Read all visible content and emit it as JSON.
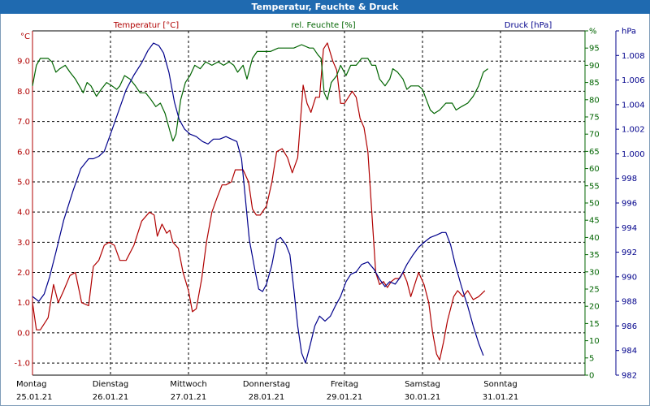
{
  "chart_data": {
    "type": "line",
    "title": "Temperatur, Feuchte & Druck",
    "x_range": [
      0,
      7
    ],
    "x_ticks": [
      {
        "day": "Montag",
        "date": "25.01.21"
      },
      {
        "day": "Dienstag",
        "date": "26.01.21"
      },
      {
        "day": "Mittwoch",
        "date": "27.01.21"
      },
      {
        "day": "Donnerstag",
        "date": "28.01.21"
      },
      {
        "day": "Freitag",
        "date": "29.01.21"
      },
      {
        "day": "Samstag",
        "date": "30.01.21"
      },
      {
        "day": "Sonntag",
        "date": "31.01.21"
      }
    ],
    "axes": {
      "temperature": {
        "unit": "°C",
        "ylim": [
          -1.4,
          10.0
        ],
        "position": "left",
        "ticks": [
          "-1.0",
          "0.0",
          "1.0",
          "2.0",
          "3.0",
          "4.0",
          "5.0",
          "6.0",
          "7.0",
          "8.0",
          "9.0"
        ],
        "tick_values": [
          -1,
          0,
          1,
          2,
          3,
          4,
          5,
          6,
          7,
          8,
          9
        ]
      },
      "humidity": {
        "unit": "%",
        "ylim": [
          0,
          100
        ],
        "position": "right-inner",
        "ticks": [
          "0",
          "5",
          "10",
          "15",
          "20",
          "25",
          "30",
          "35",
          "40",
          "45",
          "50",
          "55",
          "60",
          "65",
          "70",
          "75",
          "80",
          "85",
          "90",
          "95",
          "%"
        ],
        "tick_values": [
          0,
          5,
          10,
          15,
          20,
          25,
          30,
          35,
          40,
          45,
          50,
          55,
          60,
          65,
          70,
          75,
          80,
          85,
          90,
          95,
          100
        ]
      },
      "pressure": {
        "unit": "hPa",
        "ylim": [
          982,
          1010
        ],
        "position": "right-outer",
        "ticks": [
          "982",
          "984",
          "986",
          "988",
          "990",
          "992",
          "994",
          "996",
          "998",
          "1.000",
          "1.002",
          "1.004",
          "1.006",
          "1.008",
          "hPa"
        ],
        "tick_values": [
          982,
          984,
          986,
          988,
          990,
          992,
          994,
          996,
          998,
          1000,
          1002,
          1004,
          1006,
          1008,
          1010
        ]
      }
    },
    "grid": true,
    "series": [
      {
        "name": "Temperatur [°C]",
        "axis": "temperature",
        "color": "#b00000",
        "points": [
          [
            0.0,
            1.0
          ],
          [
            0.05,
            0.1
          ],
          [
            0.1,
            0.1
          ],
          [
            0.2,
            0.5
          ],
          [
            0.27,
            1.6
          ],
          [
            0.33,
            1.0
          ],
          [
            0.4,
            1.4
          ],
          [
            0.48,
            1.9
          ],
          [
            0.55,
            2.0
          ],
          [
            0.63,
            1.0
          ],
          [
            0.72,
            0.9
          ],
          [
            0.78,
            2.2
          ],
          [
            0.85,
            2.4
          ],
          [
            0.92,
            2.9
          ],
          [
            0.98,
            3.0
          ],
          [
            1.05,
            2.9
          ],
          [
            1.12,
            2.4
          ],
          [
            1.2,
            2.4
          ],
          [
            1.3,
            2.9
          ],
          [
            1.4,
            3.7
          ],
          [
            1.5,
            4.0
          ],
          [
            1.56,
            3.9
          ],
          [
            1.6,
            3.2
          ],
          [
            1.66,
            3.6
          ],
          [
            1.72,
            3.3
          ],
          [
            1.76,
            3.4
          ],
          [
            1.8,
            3.0
          ],
          [
            1.87,
            2.8
          ],
          [
            1.93,
            2.0
          ],
          [
            2.0,
            1.4
          ],
          [
            2.05,
            0.7
          ],
          [
            2.1,
            0.8
          ],
          [
            2.17,
            1.8
          ],
          [
            2.23,
            3.0
          ],
          [
            2.3,
            4.0
          ],
          [
            2.37,
            4.5
          ],
          [
            2.43,
            4.9
          ],
          [
            2.48,
            4.9
          ],
          [
            2.55,
            5.0
          ],
          [
            2.6,
            5.4
          ],
          [
            2.7,
            5.4
          ],
          [
            2.77,
            5.0
          ],
          [
            2.82,
            4.1
          ],
          [
            2.87,
            3.9
          ],
          [
            2.92,
            3.9
          ],
          [
            3.0,
            4.2
          ],
          [
            3.07,
            5.0
          ],
          [
            3.13,
            6.0
          ],
          [
            3.2,
            6.1
          ],
          [
            3.27,
            5.8
          ],
          [
            3.33,
            5.3
          ],
          [
            3.4,
            5.8
          ],
          [
            3.47,
            8.2
          ],
          [
            3.52,
            7.6
          ],
          [
            3.57,
            7.3
          ],
          [
            3.63,
            7.8
          ],
          [
            3.68,
            7.8
          ],
          [
            3.73,
            9.4
          ],
          [
            3.78,
            9.6
          ],
          [
            3.85,
            9.0
          ],
          [
            3.9,
            8.7
          ],
          [
            3.95,
            7.6
          ],
          [
            4.0,
            7.6
          ],
          [
            4.05,
            7.8
          ],
          [
            4.1,
            8.0
          ],
          [
            4.15,
            7.8
          ],
          [
            4.2,
            7.1
          ],
          [
            4.25,
            6.8
          ],
          [
            4.3,
            6.0
          ],
          [
            4.35,
            4.0
          ],
          [
            4.4,
            2.0
          ],
          [
            4.45,
            1.6
          ],
          [
            4.5,
            1.7
          ],
          [
            4.55,
            1.5
          ],
          [
            4.6,
            1.7
          ],
          [
            4.65,
            1.8
          ],
          [
            4.7,
            1.8
          ],
          [
            4.75,
            2.0
          ],
          [
            4.8,
            1.7
          ],
          [
            4.85,
            1.2
          ],
          [
            4.9,
            1.6
          ],
          [
            4.95,
            2.0
          ],
          [
            5.02,
            1.6
          ],
          [
            5.08,
            1.0
          ],
          [
            5.13,
            0.0
          ],
          [
            5.18,
            -0.7
          ],
          [
            5.22,
            -0.9
          ],
          [
            5.27,
            -0.3
          ],
          [
            5.32,
            0.4
          ],
          [
            5.4,
            1.2
          ],
          [
            5.45,
            1.4
          ],
          [
            5.52,
            1.2
          ],
          [
            5.58,
            1.4
          ],
          [
            5.65,
            1.1
          ],
          [
            5.72,
            1.2
          ],
          [
            5.8,
            1.4
          ]
        ]
      },
      {
        "name": "rel. Feuchte [%]",
        "axis": "humidity",
        "color": "#006400",
        "points": [
          [
            0.0,
            84
          ],
          [
            0.05,
            90
          ],
          [
            0.1,
            92
          ],
          [
            0.2,
            92
          ],
          [
            0.25,
            91
          ],
          [
            0.3,
            88
          ],
          [
            0.35,
            89
          ],
          [
            0.42,
            90
          ],
          [
            0.48,
            88
          ],
          [
            0.55,
            86
          ],
          [
            0.6,
            84
          ],
          [
            0.65,
            82
          ],
          [
            0.7,
            85
          ],
          [
            0.75,
            84
          ],
          [
            0.82,
            81
          ],
          [
            0.88,
            83
          ],
          [
            0.95,
            85
          ],
          [
            1.02,
            84
          ],
          [
            1.08,
            83
          ],
          [
            1.12,
            84
          ],
          [
            1.18,
            87
          ],
          [
            1.25,
            86
          ],
          [
            1.32,
            84
          ],
          [
            1.38,
            82
          ],
          [
            1.45,
            82
          ],
          [
            1.52,
            80
          ],
          [
            1.58,
            78
          ],
          [
            1.64,
            79
          ],
          [
            1.7,
            76
          ],
          [
            1.76,
            71
          ],
          [
            1.8,
            68
          ],
          [
            1.84,
            70
          ],
          [
            1.9,
            80
          ],
          [
            1.96,
            85
          ],
          [
            2.02,
            87
          ],
          [
            2.08,
            90
          ],
          [
            2.15,
            89
          ],
          [
            2.22,
            91
          ],
          [
            2.3,
            90
          ],
          [
            2.38,
            91
          ],
          [
            2.45,
            90
          ],
          [
            2.52,
            91
          ],
          [
            2.58,
            90
          ],
          [
            2.63,
            88
          ],
          [
            2.7,
            90
          ],
          [
            2.75,
            86
          ],
          [
            2.82,
            92
          ],
          [
            2.88,
            94
          ],
          [
            2.95,
            94
          ],
          [
            3.05,
            94
          ],
          [
            3.15,
            95
          ],
          [
            3.25,
            95
          ],
          [
            3.35,
            95
          ],
          [
            3.45,
            96
          ],
          [
            3.55,
            95
          ],
          [
            3.6,
            95
          ],
          [
            3.66,
            93
          ],
          [
            3.7,
            92
          ],
          [
            3.74,
            82
          ],
          [
            3.78,
            80
          ],
          [
            3.83,
            85
          ],
          [
            3.9,
            87
          ],
          [
            3.95,
            90
          ],
          [
            4.02,
            87
          ],
          [
            4.08,
            90
          ],
          [
            4.15,
            90
          ],
          [
            4.22,
            92
          ],
          [
            4.3,
            92
          ],
          [
            4.35,
            90
          ],
          [
            4.4,
            90
          ],
          [
            4.45,
            86
          ],
          [
            4.52,
            84
          ],
          [
            4.58,
            86
          ],
          [
            4.62,
            89
          ],
          [
            4.68,
            88
          ],
          [
            4.75,
            86
          ],
          [
            4.8,
            83
          ],
          [
            4.85,
            84
          ],
          [
            4.9,
            84
          ],
          [
            4.95,
            84
          ],
          [
            5.0,
            83
          ],
          [
            5.05,
            80
          ],
          [
            5.1,
            77
          ],
          [
            5.15,
            76
          ],
          [
            5.22,
            77
          ],
          [
            5.3,
            79
          ],
          [
            5.38,
            79
          ],
          [
            5.43,
            77
          ],
          [
            5.5,
            78
          ],
          [
            5.58,
            79
          ],
          [
            5.65,
            81
          ],
          [
            5.72,
            84
          ],
          [
            5.78,
            88
          ],
          [
            5.84,
            89
          ]
        ]
      },
      {
        "name": "Druck [hPa]",
        "axis": "pressure",
        "color": "#00008b",
        "points": [
          [
            0.0,
            988.4
          ],
          [
            0.08,
            988.0
          ],
          [
            0.15,
            988.6
          ],
          [
            0.22,
            990.0
          ],
          [
            0.3,
            992.0
          ],
          [
            0.4,
            994.6
          ],
          [
            0.52,
            997.0
          ],
          [
            0.62,
            998.8
          ],
          [
            0.72,
            999.6
          ],
          [
            0.78,
            999.6
          ],
          [
            0.85,
            999.8
          ],
          [
            0.92,
            1000.2
          ],
          [
            1.0,
            1001.6
          ],
          [
            1.1,
            1003.4
          ],
          [
            1.2,
            1005.2
          ],
          [
            1.3,
            1006.4
          ],
          [
            1.4,
            1007.4
          ],
          [
            1.48,
            1008.4
          ],
          [
            1.55,
            1009.0
          ],
          [
            1.62,
            1008.8
          ],
          [
            1.68,
            1008.2
          ],
          [
            1.75,
            1006.6
          ],
          [
            1.82,
            1004.2
          ],
          [
            1.88,
            1002.8
          ],
          [
            1.95,
            1002.0
          ],
          [
            2.02,
            1001.6
          ],
          [
            2.1,
            1001.4
          ],
          [
            2.18,
            1001.0
          ],
          [
            2.25,
            1000.8
          ],
          [
            2.32,
            1001.2
          ],
          [
            2.4,
            1001.2
          ],
          [
            2.48,
            1001.4
          ],
          [
            2.55,
            1001.2
          ],
          [
            2.62,
            1001.0
          ],
          [
            2.68,
            999.6
          ],
          [
            2.72,
            997.0
          ],
          [
            2.78,
            993.0
          ],
          [
            2.85,
            990.6
          ],
          [
            2.9,
            989.0
          ],
          [
            2.95,
            988.8
          ],
          [
            3.0,
            989.4
          ],
          [
            3.07,
            991.0
          ],
          [
            3.13,
            993.0
          ],
          [
            3.18,
            993.2
          ],
          [
            3.25,
            992.6
          ],
          [
            3.3,
            991.8
          ],
          [
            3.35,
            989.0
          ],
          [
            3.4,
            986.0
          ],
          [
            3.45,
            983.8
          ],
          [
            3.5,
            983.0
          ],
          [
            3.55,
            984.2
          ],
          [
            3.62,
            986.0
          ],
          [
            3.68,
            986.8
          ],
          [
            3.75,
            986.4
          ],
          [
            3.82,
            986.8
          ],
          [
            3.88,
            987.6
          ],
          [
            3.95,
            988.4
          ],
          [
            4.02,
            989.6
          ],
          [
            4.08,
            990.2
          ],
          [
            4.15,
            990.4
          ],
          [
            4.22,
            991.0
          ],
          [
            4.3,
            991.2
          ],
          [
            4.38,
            990.6
          ],
          [
            4.45,
            989.8
          ],
          [
            4.52,
            989.2
          ],
          [
            4.58,
            989.6
          ],
          [
            4.65,
            989.4
          ],
          [
            4.72,
            990.0
          ],
          [
            4.8,
            991.0
          ],
          [
            4.88,
            991.8
          ],
          [
            4.95,
            992.4
          ],
          [
            5.02,
            992.8
          ],
          [
            5.1,
            993.2
          ],
          [
            5.18,
            993.4
          ],
          [
            5.25,
            993.6
          ],
          [
            5.3,
            993.6
          ],
          [
            5.36,
            992.6
          ],
          [
            5.42,
            991.0
          ],
          [
            5.5,
            989.2
          ],
          [
            5.58,
            987.6
          ],
          [
            5.65,
            986.0
          ],
          [
            5.72,
            984.6
          ],
          [
            5.78,
            983.6
          ]
        ]
      }
    ]
  }
}
